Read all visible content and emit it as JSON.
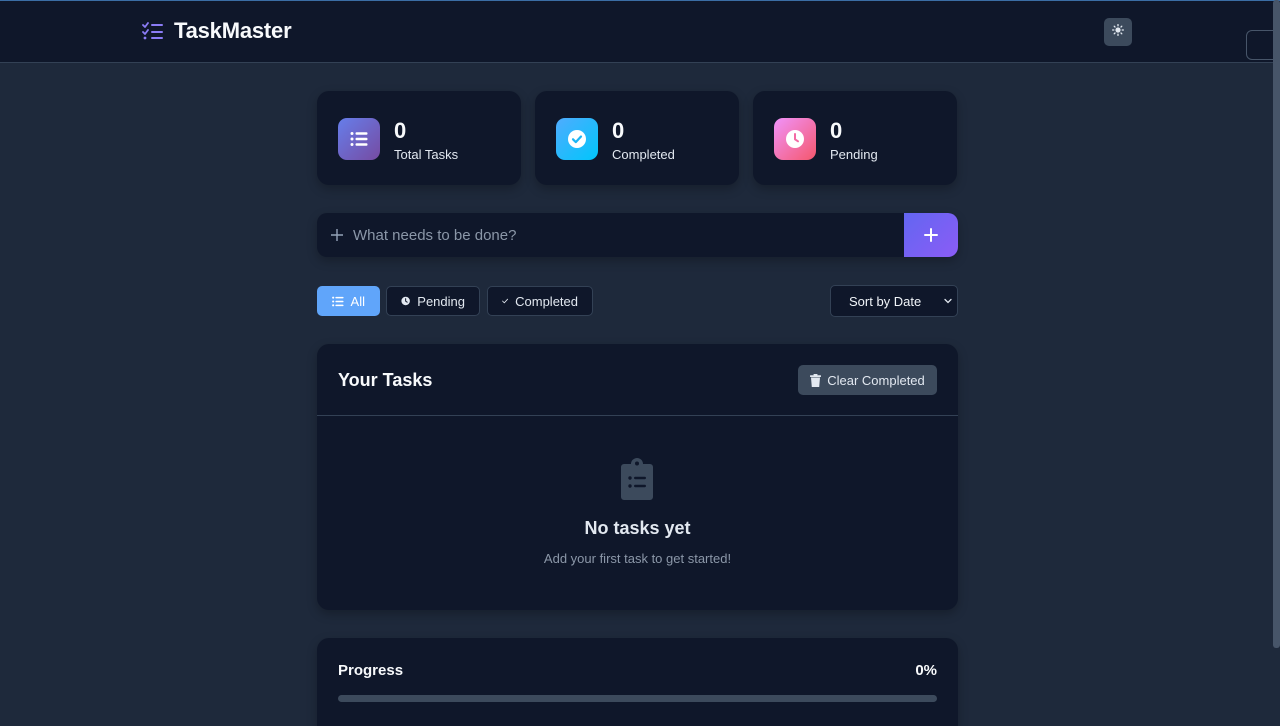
{
  "app": {
    "title": "TaskMaster"
  },
  "stats": [
    {
      "value": "0",
      "label": "Total Tasks",
      "icon": "list-icon",
      "colors": [
        "#667eea",
        "#764ba2"
      ]
    },
    {
      "value": "0",
      "label": "Completed",
      "icon": "check-circle-icon",
      "colors": [
        "#4facfe",
        "#00c6fb"
      ]
    },
    {
      "value": "0",
      "label": "Pending",
      "icon": "clock-icon",
      "colors": [
        "#f093fb",
        "#f5576c"
      ]
    }
  ],
  "add_task": {
    "placeholder": "What needs to be done?",
    "button_label": "+"
  },
  "filters": [
    {
      "label": "All",
      "active": true
    },
    {
      "label": "Pending",
      "active": false
    },
    {
      "label": "Completed",
      "active": false
    }
  ],
  "sort": {
    "selected": "Sort by Date"
  },
  "tasks_panel": {
    "title": "Your Tasks",
    "clear_button": "Clear Completed",
    "empty_title": "No tasks yet",
    "empty_subtitle": "Add your first task to get started!"
  },
  "progress": {
    "title": "Progress",
    "value_label": "0%",
    "fraction": 0
  },
  "colors": {
    "accent": "#60a5fa",
    "brand": "#6366f1",
    "background": "#1e293b",
    "card": "#0f172a"
  }
}
